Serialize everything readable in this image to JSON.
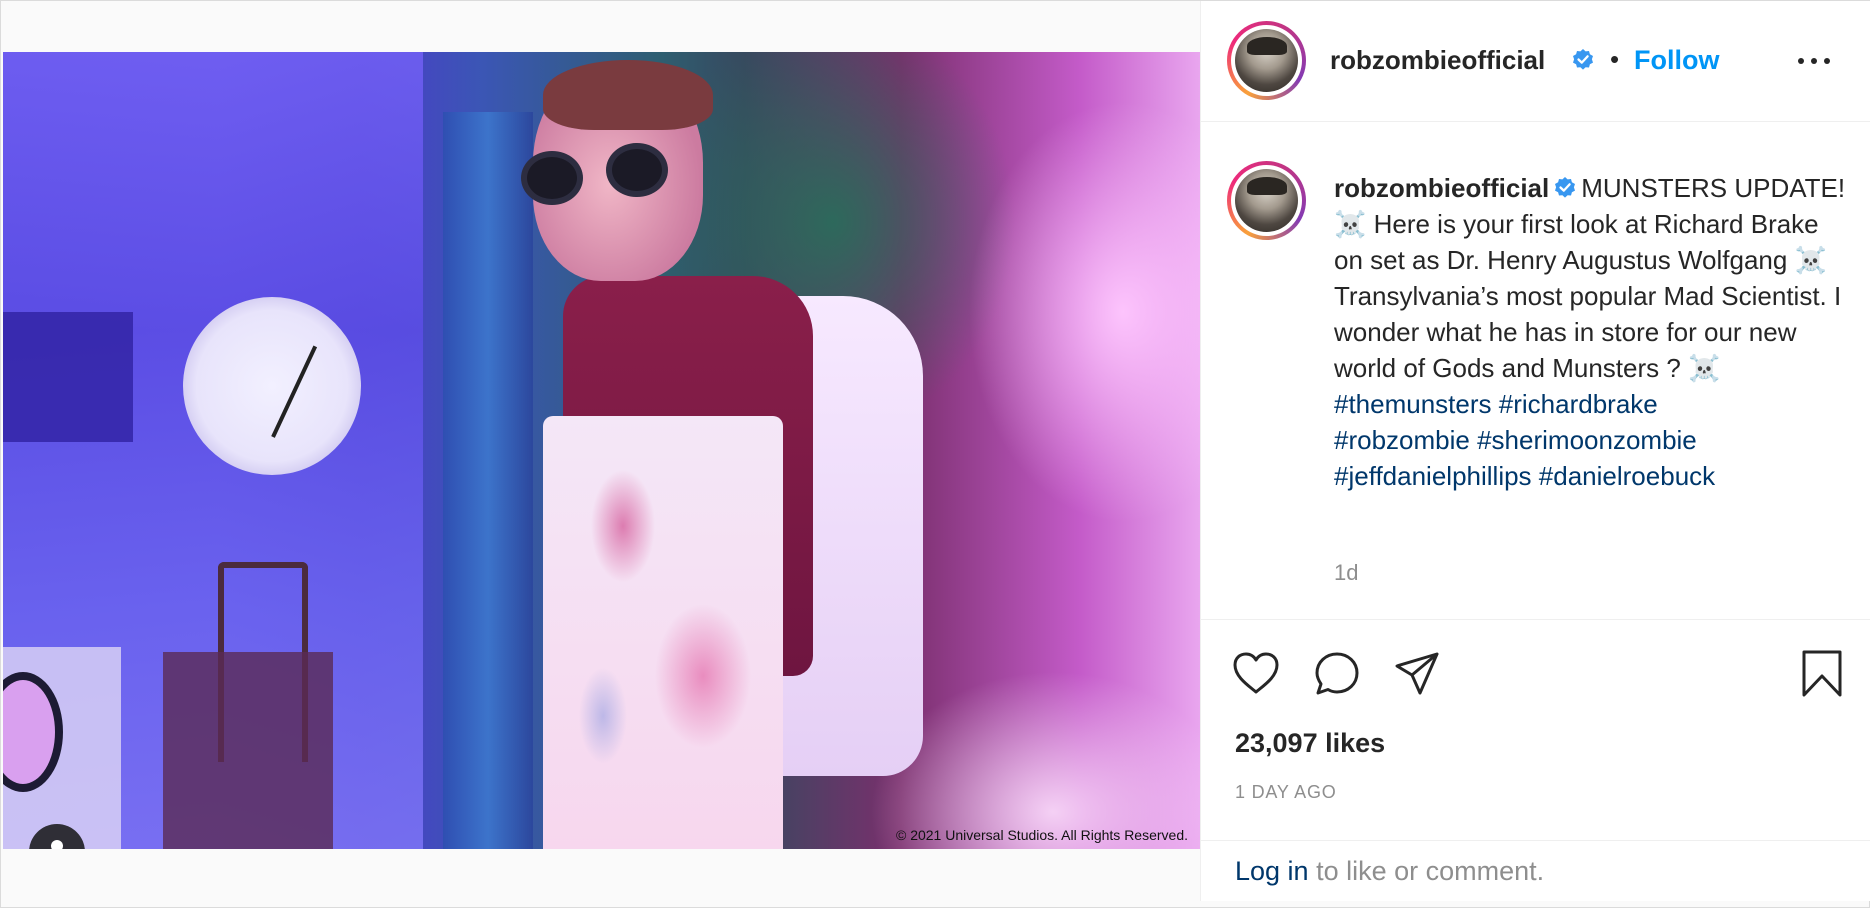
{
  "post": {
    "username": "robzombieofficial",
    "follow_label": "Follow",
    "dot": "•",
    "media": {
      "copyright": "© 2021 Universal Studios. All Rights Reserved."
    },
    "caption": {
      "username": "robzombieofficial",
      "body": "MUNSTERS UPDATE! ☠️ Here is your first look at Richard Brake on set as Dr. Henry Augustus Wolfgang ☠️ Transylvania’s most popular Mad Scientist. I wonder what he has in store for our new world of Gods and Munsters ? ☠️",
      "hashtags": [
        "#themunsters",
        "#richardbrake",
        "#robzombie",
        "#sherimoonzombie",
        "#jeffdanielphillips",
        "#danielroebuck"
      ],
      "time_ago": "1d"
    },
    "likes": "23,097 likes",
    "date": "1 DAY AGO",
    "login": {
      "link": "Log in",
      "rest": " to like or comment."
    }
  },
  "icons": {
    "verified": "verified-badge-icon",
    "more": "more-options-icon",
    "like": "heart-icon",
    "comment": "comment-icon",
    "share": "paper-plane-icon",
    "save": "bookmark-icon",
    "user_tag": "user-tag-icon"
  },
  "colors": {
    "accent": "#0095f6",
    "hashtag": "#00376b",
    "text": "#262626",
    "muted": "#8e8e8e",
    "verified": "#3897f0"
  }
}
